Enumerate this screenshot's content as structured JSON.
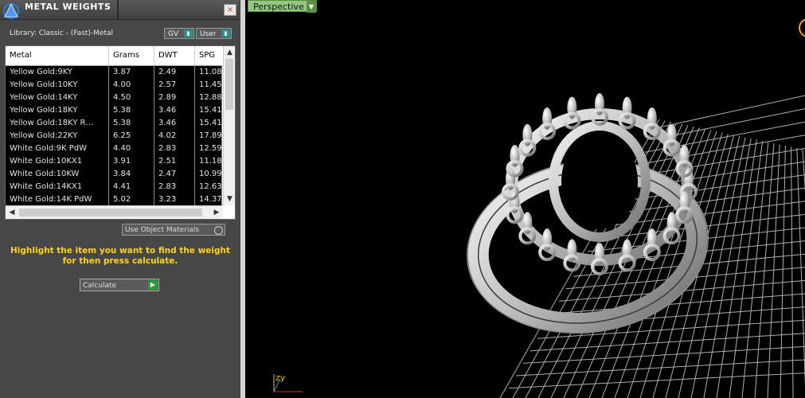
{
  "panel": {
    "title": "METAL WEIGHTS",
    "close": "×",
    "library_label": "Library: Classic - (Fast)-Metal",
    "dropdowns": {
      "gv": "GV",
      "user": "User"
    },
    "columns": [
      "Metal",
      "Grams",
      "DWT",
      "SPG"
    ],
    "rows": [
      [
        "Yellow Gold:9KY",
        "3.87",
        "2.49",
        "11.08"
      ],
      [
        "Yellow Gold:10KY",
        "4.00",
        "2.57",
        "11.45"
      ],
      [
        "Yellow Gold:14KY",
        "4.50",
        "2.89",
        "12.88"
      ],
      [
        "Yellow Gold:18KY",
        "5.38",
        "3.46",
        "15.41"
      ],
      [
        "Yellow Gold:18KY R…",
        "5.38",
        "3.46",
        "15.41"
      ],
      [
        "Yellow Gold:22KY",
        "6.25",
        "4.02",
        "17.89"
      ],
      [
        "White Gold:9K PdW",
        "4.40",
        "2.83",
        "12.59"
      ],
      [
        "White Gold:10KX1",
        "3.91",
        "2.51",
        "11.18"
      ],
      [
        "White Gold:10KW",
        "3.84",
        "2.47",
        "10.99"
      ],
      [
        "White Gold:14KX1",
        "4.41",
        "2.83",
        "12.63"
      ],
      [
        "White Gold:14K PdW",
        "5.02",
        "3.23",
        "14.37"
      ]
    ],
    "use_object_materials": "Use Object Materials",
    "hint": "Highlight the item you want to find the weight for then press calculate.",
    "calculate_button": "Calculate"
  },
  "viewport": {
    "tab_label": "Perspective",
    "axis_label": "zy"
  },
  "colors": {
    "hint_text": "#ffd21f",
    "perspective_tab": "#93c77e",
    "grid": "#cfcfcf"
  }
}
